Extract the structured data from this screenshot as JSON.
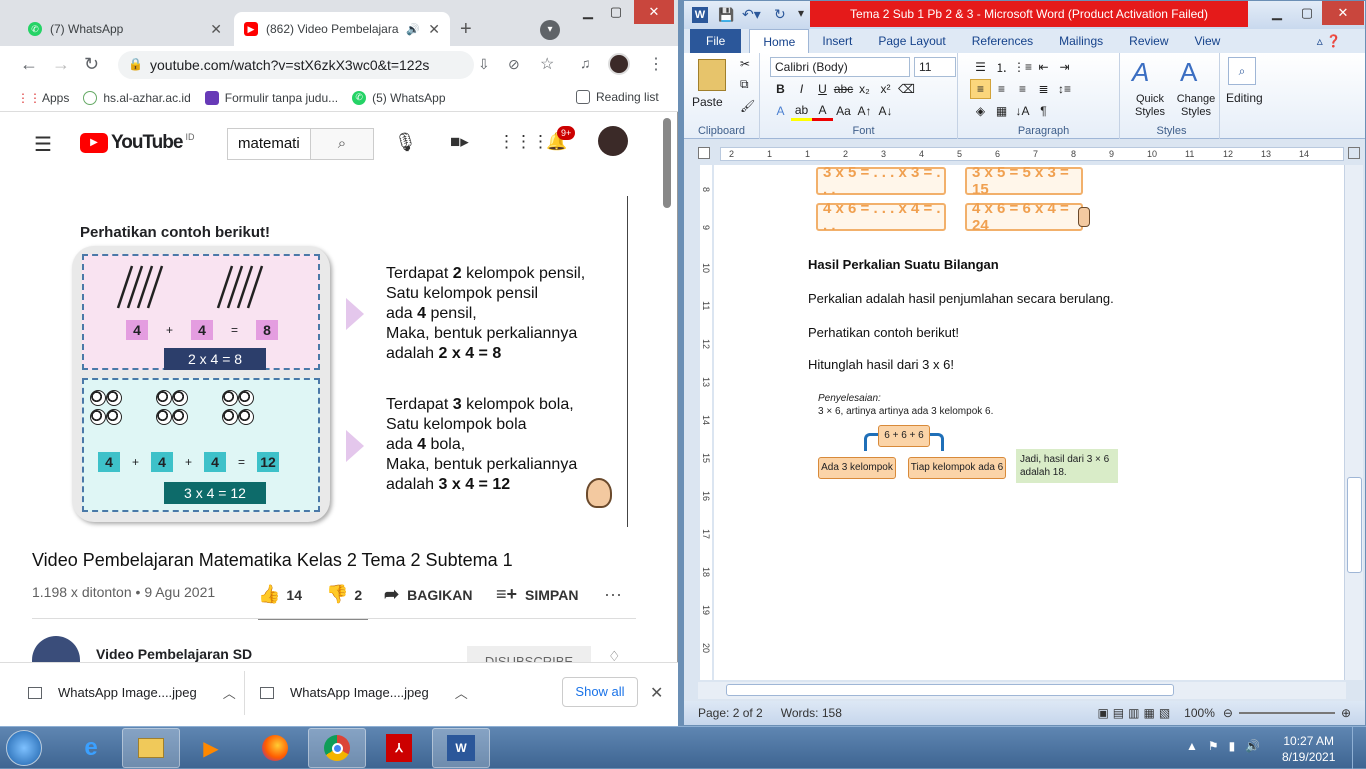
{
  "chrome": {
    "tabs": [
      {
        "title": "(7) WhatsApp",
        "icon": "whatsapp-icon"
      },
      {
        "title": "(862) Video Pembelajara",
        "icon": "youtube-icon"
      }
    ],
    "url": "youtube.com/watch?v=stX6zkX3wc0&t=122s",
    "bookmarks": [
      {
        "label": "Apps"
      },
      {
        "label": "hs.al-azhar.ac.id"
      },
      {
        "label": "Formulir tanpa judu..."
      },
      {
        "label": "(5) WhatsApp"
      }
    ],
    "reading_list": "Reading list"
  },
  "youtube": {
    "logo": "YouTube",
    "logo_sup": "ID",
    "search_value": "matemati",
    "notif_badge": "9+",
    "video_title": "Video Pembelajaran Matematika Kelas 2 Tema 2 Subtema 1",
    "meta": "1.198 x ditonton • 9 Agu 2021",
    "likes": "14",
    "dislikes": "2",
    "share": "BAGIKAN",
    "save": "SIMPAN",
    "channel": "Video Pembelajaran SD",
    "subscribe": "DISUBSCRIBE"
  },
  "slide": {
    "heading": "Perhatikan contoh berikut!",
    "row1": {
      "a": "4",
      "plus": "+",
      "b": "4",
      "eq": "=",
      "c": "8",
      "result": "2 x 4 = 8"
    },
    "row2": {
      "a": "4",
      "b": "4",
      "c": "4",
      "d": "12",
      "result": "3 x 4 = 12"
    },
    "text1": {
      "l1a": "Terdapat ",
      "l1b": "2",
      "l1c": " kelompok pensil,",
      "l2": "Satu kelompok pensil",
      "l3a": "ada ",
      "l3b": "4",
      "l3c": " pensil,",
      "l4": "Maka, bentuk perkaliannya",
      "l5a": "adalah ",
      "l5b": "2 x 4 = 8"
    },
    "text2": {
      "l1a": "Terdapat ",
      "l1b": "3",
      "l1c": " kelompok bola,",
      "l2": "Satu kelompok bola",
      "l3a": "ada ",
      "l3b": "4",
      "l3c": " bola,",
      "l4": "Maka, bentuk perkaliannya",
      "l5a": "adalah ",
      "l5b": "3 x 4 = 12"
    }
  },
  "downloads": {
    "items": [
      "WhatsApp Image....jpeg",
      "WhatsApp Image....jpeg"
    ],
    "show_all": "Show all"
  },
  "word": {
    "title": "Tema 2 Sub 1 Pb 2 & 3  -  Microsoft Word (Product Activation Failed)",
    "tabs": [
      "File",
      "Home",
      "Insert",
      "Page Layout",
      "References",
      "Mailings",
      "Review",
      "View"
    ],
    "font_name": "Calibri (Body)",
    "font_size": "11",
    "groups": {
      "clipboard": "Clipboard",
      "paste": "Paste",
      "font": "Font",
      "paragraph": "Paragraph",
      "styles": "Styles",
      "quick_styles": "Quick Styles",
      "change_styles": "Change Styles",
      "editing": "Editing"
    },
    "boxes": [
      "3 x 5 = . . . x 3 = . . .",
      "3 x 5 = 5 x 3 = 15",
      "4 x 6 = . . . x 4 = . . .",
      "4 x 6 = 6 x 4 = 24"
    ],
    "heading": "Hasil Perkalian Suatu Bilangan",
    "p1": "Perkalian adalah hasil penjumlahan secara berulang.",
    "p2": "Perhatikan contoh berikut!",
    "p3": "Hitunglah hasil dari 3 x 6!",
    "fig": {
      "label": "Penyelesaian:",
      "desc": "3 × 6, artinya artinya ada 3 kelompok 6.",
      "sum": "6 + 6 + 6",
      "left": "Ada 3 kelompok",
      "right": "Tiap kelompok ada 6",
      "result": "Jadi, hasil dari 3 × 6 adalah 18."
    },
    "status": {
      "page": "Page: 2 of 2",
      "words": "Words: 158",
      "zoom": "100%"
    },
    "ruler_numbers": [
      "2",
      "1",
      "1",
      "2",
      "3",
      "4",
      "5",
      "6",
      "7",
      "8",
      "9",
      "10",
      "11",
      "12",
      "13",
      "14"
    ],
    "vruler_numbers": [
      "8",
      "9",
      "10",
      "11",
      "12",
      "13",
      "14",
      "15",
      "16",
      "17",
      "18",
      "19",
      "20"
    ]
  },
  "taskbar": {
    "time": "10:27 AM",
    "date": "8/19/2021"
  },
  "colors": {
    "yt_red": "#ff0000",
    "word_blue": "#2b579a",
    "pink_box": "#f9e3f1",
    "teal_box": "#dff6f5"
  }
}
